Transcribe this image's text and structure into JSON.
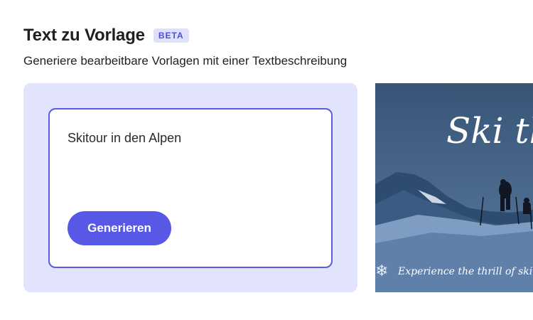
{
  "header": {
    "title": "Text zu Vorlage",
    "badge": "BETA",
    "subtitle": "Generiere bearbeitbare Vorlagen mit einer Textbeschreibung"
  },
  "prompt": {
    "text": "Skitour in den Alpen",
    "generate_label": "Generieren"
  },
  "preview": {
    "title": "Ski th",
    "caption": "Experience the thrill of skiin",
    "icon": "snowflake-icon"
  },
  "colors": {
    "accent": "#5758e6",
    "panel_bg": "#e2e3fd",
    "badge_bg": "#dfe0fb"
  }
}
